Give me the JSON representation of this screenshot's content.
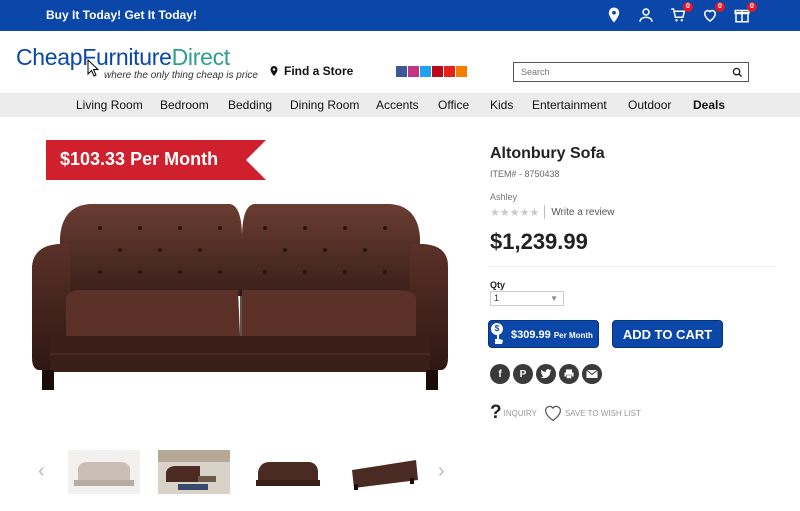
{
  "topbar": {
    "promo": "Buy It Today! Get It Today!",
    "icons": [
      {
        "name": "location-icon",
        "badge": ""
      },
      {
        "name": "account-icon",
        "badge": ""
      },
      {
        "name": "cart-icon",
        "badge": "0"
      },
      {
        "name": "heart-icon",
        "badge": "0"
      },
      {
        "name": "gift-icon",
        "badge": "0"
      }
    ]
  },
  "header": {
    "logo_part1": "Cheap",
    "logo_part2": "Furniture",
    "logo_part3": "Direct",
    "tagline": "where the only thing cheap is price",
    "find_store": "Find a Store",
    "search_placeholder": "Search"
  },
  "nav": {
    "items": [
      "Living Room",
      "Bedroom",
      "Bedding",
      "Dining Room",
      "Accents",
      "Office",
      "Kids",
      "Entertainment",
      "Outdoor",
      "Deals"
    ]
  },
  "banner": {
    "text": "$103.33  Per Month"
  },
  "product": {
    "title": "Altonbury Sofa",
    "item_number": "ITEM# - 8750438",
    "vendor": "Ashley",
    "stars": "★★★★★",
    "rating": 0,
    "write_review": "Write a review",
    "price": "$1,239.99",
    "qty_label": "Qty",
    "qty_value": "1",
    "monthly_icon": "$",
    "monthly_amount": "$309.99",
    "monthly_suffix": "Per Month",
    "add_to_cart": "ADD TO CART",
    "inquiry": "INQUIRY",
    "wish_list": "SAVE TO WISH LIST"
  },
  "colors": {
    "brand_blue": "#0a47a8",
    "banner_red": "#d0202e",
    "logo_teal": "#2ca08e",
    "sofa_brown": "#4a2a22"
  },
  "social_icons": [
    "facebook-icon",
    "instagram-icon",
    "twitter-icon",
    "pinterest-icon",
    "youtube-icon",
    "blogger-icon"
  ],
  "share_icons": [
    "facebook-share-icon",
    "pinterest-share-icon",
    "twitter-share-icon",
    "print-icon",
    "email-icon"
  ]
}
